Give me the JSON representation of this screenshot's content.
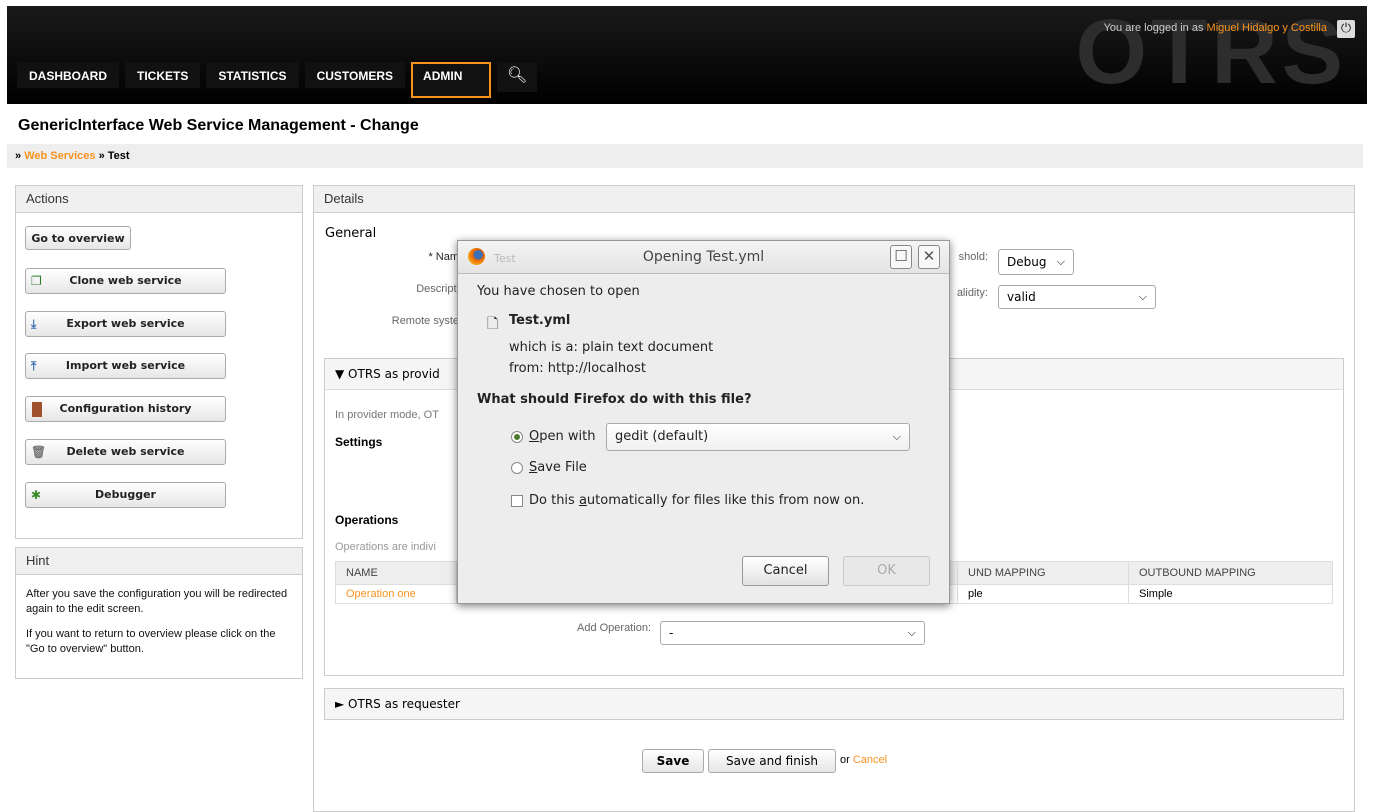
{
  "header": {
    "logo": "OTRS",
    "login_prefix": "You are logged in as",
    "user_name": "Miguel Hidalgo y Costilla",
    "nav": [
      "DASHBOARD",
      "TICKETS",
      "STATISTICS",
      "CUSTOMERS",
      "ADMIN"
    ]
  },
  "page": {
    "title": "GenericInterface Web Service Management - Change",
    "breadcrumb_link": "Web Services",
    "breadcrumb_current": "Test"
  },
  "actions": {
    "title": "Actions",
    "go_overview": "Go to overview",
    "clone": "Clone web service",
    "export": "Export web service",
    "import": "Import web service",
    "history": "Configuration history",
    "delete": "Delete web service",
    "debugger": "Debugger"
  },
  "hint": {
    "title": "Hint",
    "p1": "After you save the configuration you will be redirected again to the edit screen.",
    "p2": "If you want to return to overview please click on the \"Go to overview\" button."
  },
  "details": {
    "title": "Details",
    "general": "General",
    "name_label": "* Nam",
    "description_label": "Descripti",
    "remote_label": "Remote syste",
    "threshold_label": "shold:",
    "threshold_value": "Debug",
    "validity_label": "alidity:",
    "validity_value": "valid",
    "provider_title": "OTRS as provid",
    "provider_text": "In provider mode, OT",
    "settings": "Settings",
    "operations": "Operations",
    "operations_text": "Operations are indivi",
    "table_headers": [
      "NAME",
      "UND MAPPING",
      "OUTBOUND MAPPING"
    ],
    "op_name": "Operation one",
    "op_inbound": "ple",
    "op_outbound": "Simple",
    "add_operation_label": "Add Operation:",
    "add_operation_value": "-",
    "requester_title": "OTRS as requester",
    "save": "Save",
    "save_finish": "Save and finish",
    "or": "or",
    "cancel": "Cancel"
  },
  "dialog": {
    "title": "Opening Test.yml",
    "ghost": "Test",
    "chosen": "You have chosen to open",
    "filename": "Test.yml",
    "which_is": "which is a: plain text document",
    "from": "from: http://localhost",
    "question": "What should Firefox do with this file?",
    "open_with": "Open with",
    "app": "gedit (default)",
    "save_file": "Save File",
    "auto": "Do this automatically for files like this from now on.",
    "cancel": "Cancel",
    "ok": "OK"
  }
}
